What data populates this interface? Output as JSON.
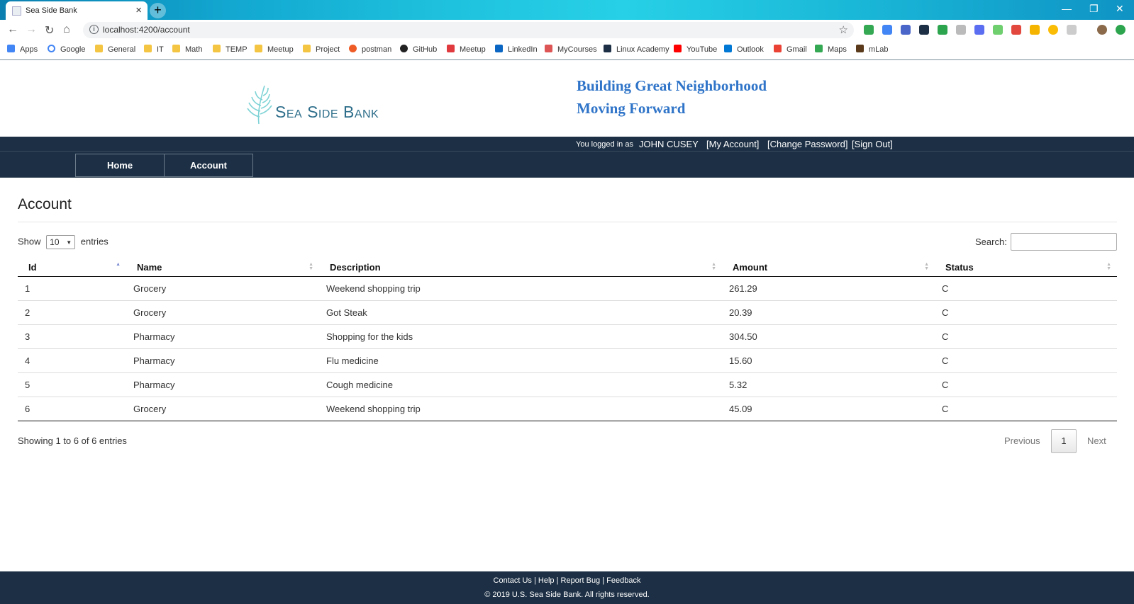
{
  "browser": {
    "tab_title": "Sea Side Bank",
    "url": "localhost:4200/account",
    "bookmarks": [
      "Apps",
      "Google",
      "General",
      "IT",
      "Math",
      "TEMP",
      "Meetup",
      "Project",
      "postman",
      "GitHub",
      "Meetup",
      "LinkedIn",
      "MyCourses",
      "Linux Academy",
      "YouTube",
      "Outlook",
      "Gmail",
      "Maps",
      "mLab"
    ]
  },
  "header": {
    "logo_text": "Sea Side Bank",
    "slogan_line1": "Building Great Neighborhood",
    "slogan_line2": "Moving Forward"
  },
  "userbar": {
    "logged_in_label": "You logged in as",
    "username": "JOHN CUSEY",
    "my_account": "[My Account]",
    "change_password": "[Change Password]",
    "sign_out": "[Sign Out]"
  },
  "nav": {
    "home": "Home",
    "account": "Account"
  },
  "page": {
    "title": "Account",
    "show_label": "Show",
    "page_size": "10",
    "entries_label": "entries",
    "search_label": "Search:",
    "search_value": "",
    "info": "Showing 1 to 6 of 6 entries",
    "previous": "Previous",
    "current_page": "1",
    "next": "Next"
  },
  "table": {
    "columns": [
      "Id",
      "Name",
      "Description",
      "Amount",
      "Status"
    ],
    "rows": [
      [
        "1",
        "Grocery",
        "Weekend shopping trip",
        "261.29",
        "C"
      ],
      [
        "2",
        "Grocery",
        "Got Steak",
        "20.39",
        "C"
      ],
      [
        "3",
        "Pharmacy",
        "Shopping for the kids",
        "304.50",
        "C"
      ],
      [
        "4",
        "Pharmacy",
        "Flu medicine",
        "15.60",
        "C"
      ],
      [
        "5",
        "Pharmacy",
        "Cough medicine",
        "5.32",
        "C"
      ],
      [
        "6",
        "Grocery",
        "Weekend shopping trip",
        "45.09",
        "C"
      ]
    ]
  },
  "footer": {
    "contact": "Contact Us",
    "help": "Help",
    "report_bug": "Report Bug",
    "feedback": "Feedback",
    "copyright": "© 2019 U.S. Sea Side Bank. All rights reserved."
  },
  "colors": {
    "navy": "#1c2f44",
    "slogan_blue": "#2f74c8",
    "logo_teal": "#7fd3d6"
  }
}
